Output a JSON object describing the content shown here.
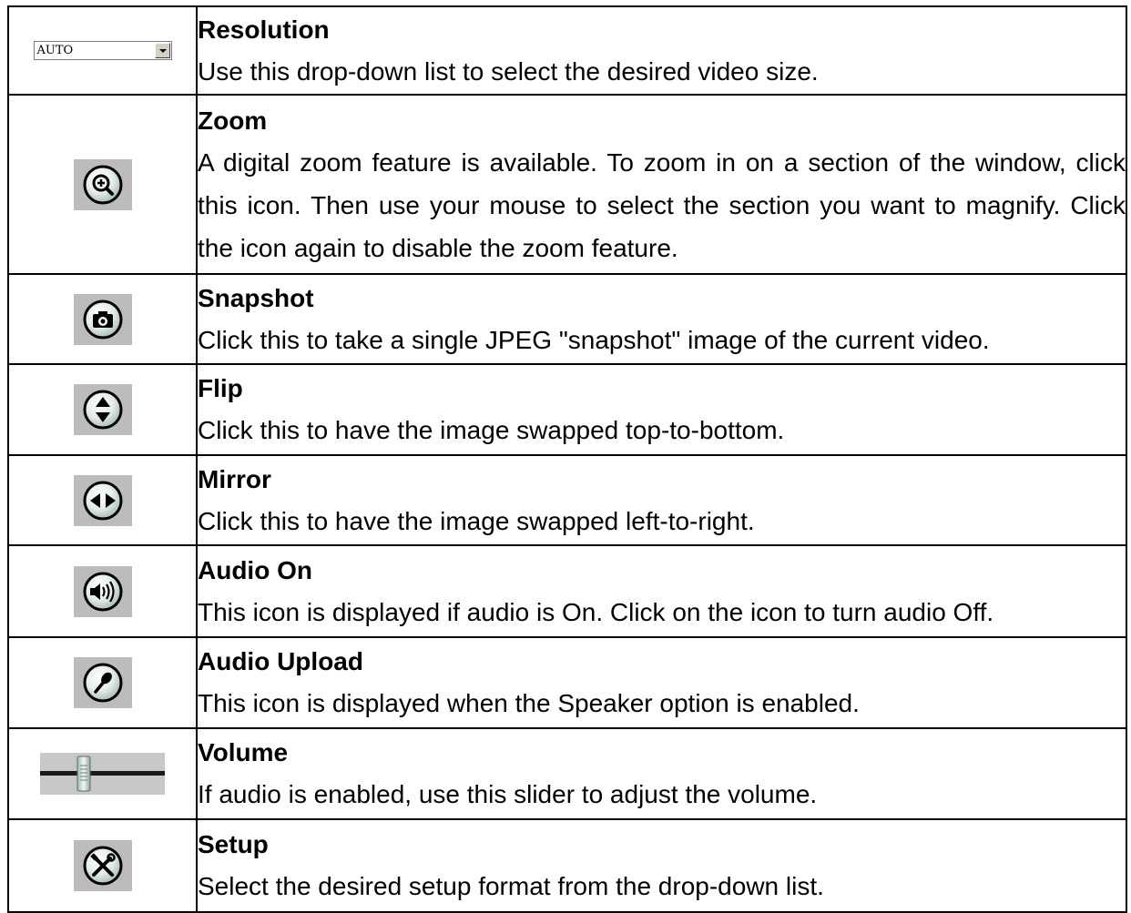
{
  "rows": [
    {
      "icon": "resolution-dropdown",
      "value": "AUTO",
      "title": "Resolution",
      "desc": "Use this drop-down list to select the desired video size."
    },
    {
      "icon": "zoom-icon",
      "title": "Zoom",
      "desc": "A digital zoom feature is available. To zoom in on a section of the window, click this icon. Then use your mouse to select the section you want to magnify. Click the icon again to disable the zoom feature."
    },
    {
      "icon": "camera-icon",
      "title": "Snapshot",
      "desc": "Click this to take a single JPEG \"snapshot\" image of the current video."
    },
    {
      "icon": "flip-icon",
      "title": "Flip",
      "desc": "Click this to have the image swapped top-to-bottom."
    },
    {
      "icon": "mirror-icon",
      "title": "Mirror",
      "desc": "Click this to have the image swapped left-to-right."
    },
    {
      "icon": "speaker-icon",
      "title": "Audio On",
      "desc": "This icon is displayed if audio is On. Click on the icon to turn audio Off."
    },
    {
      "icon": "microphone-icon",
      "title": "Audio Upload",
      "desc": "This icon is displayed when the Speaker option is enabled."
    },
    {
      "icon": "volume-slider",
      "title": "Volume",
      "desc": "If audio is enabled, use this slider to adjust the volume."
    },
    {
      "icon": "setup-tools-icon",
      "title": "Setup",
      "desc": "Select the desired setup format from the drop-down list."
    }
  ]
}
